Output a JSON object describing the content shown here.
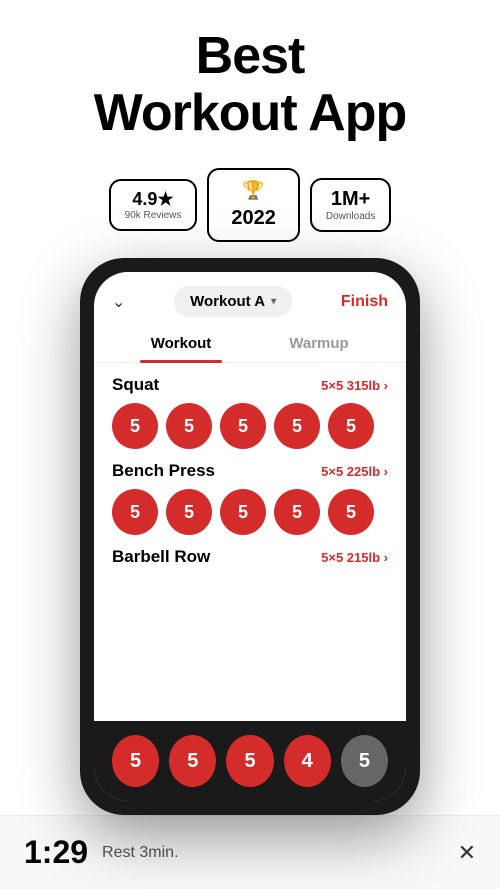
{
  "header": {
    "title_line1": "Best",
    "title_line2": "Workout App"
  },
  "badges": {
    "rating": {
      "score": "4.9★",
      "reviews": "90k Reviews"
    },
    "award": {
      "year": "2022"
    },
    "downloads": {
      "count": "1M+",
      "label": "Downloads"
    }
  },
  "app_bar": {
    "workout_selector": "Workout A",
    "finish_label": "Finish"
  },
  "tabs": [
    {
      "label": "Workout",
      "active": true
    },
    {
      "label": "Warmup",
      "active": false
    }
  ],
  "exercises": [
    {
      "name": "Squat",
      "meta": "5×5 315lb ›",
      "sets": [
        5,
        5,
        5,
        5,
        5
      ],
      "grey": []
    },
    {
      "name": "Bench Press",
      "meta": "5×5 225lb ›",
      "sets": [
        5,
        5,
        5,
        5,
        5
      ],
      "grey": []
    },
    {
      "name": "Barbell Row",
      "meta": "5×5 215lb ›",
      "sets": [
        5,
        5,
        5,
        4,
        5
      ],
      "grey": [
        4
      ]
    }
  ],
  "bottom_bar": {
    "sets": [
      5,
      5,
      5,
      4,
      5
    ],
    "grey_indices": [
      4
    ]
  },
  "rest_timer": {
    "time": "1:29",
    "label": "Rest 3min."
  }
}
